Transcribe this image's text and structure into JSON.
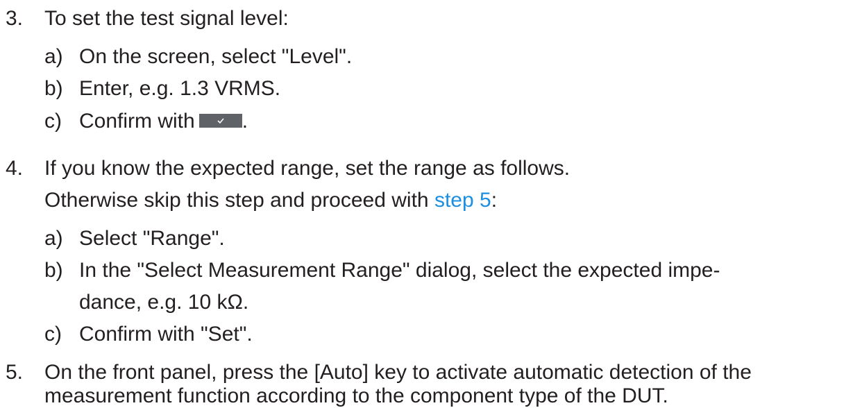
{
  "steps": [
    {
      "number": "3.",
      "text": "To set the test signal level:",
      "substeps": [
        {
          "label": "a)",
          "text": "On the screen, select \"Level\"."
        },
        {
          "label": "b)",
          "text": "Enter, e.g. 1.3 VRMS."
        },
        {
          "label": "c)",
          "text_before": "Confirm with",
          "text_after": "."
        }
      ]
    },
    {
      "number": "4.",
      "text": "If you know the expected range, set the range as follows.",
      "text_line2_before": "Otherwise skip this step and proceed with",
      "link_text": "step 5",
      "text_line2_after": ":",
      "substeps": [
        {
          "label": "a)",
          "text": "Select \"Range\"."
        },
        {
          "label": "b)",
          "text": "In the \"Select Measurement Range\" dialog, select the expected impe-",
          "text_line2": "dance, e.g. 10 kΩ."
        },
        {
          "label": "c)",
          "text": "Confirm with \"Set\"."
        }
      ]
    },
    {
      "number": "5.",
      "text": "On the front panel, press the [Auto] key to activate automatic detection of the",
      "text_line2": "measurement function according to the component type of the DUT."
    }
  ],
  "icons": {
    "confirm_key": "checkmark-icon"
  },
  "colors": {
    "text": "#231f20",
    "link": "#1c8fe0",
    "key_background": "#5f6266"
  }
}
